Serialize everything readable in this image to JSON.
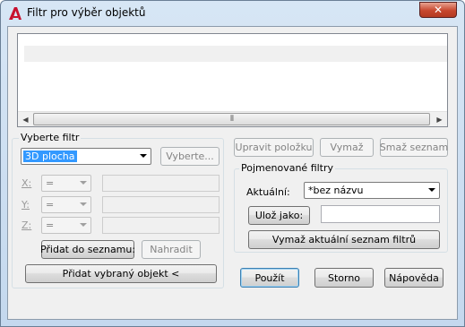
{
  "window": {
    "title": "Filtr pro výběr objektů",
    "close_symbol": "✕",
    "accent_color": "#c7472e"
  },
  "list": {
    "rows": [
      ""
    ],
    "scrollbar": {
      "left_arrow": "◀",
      "right_arrow": "▶",
      "grip": "⦀"
    }
  },
  "filter_group": {
    "title": "Vyberte filtr",
    "filter_select": {
      "value": "3D plocha"
    },
    "select_button": "Vyberte...",
    "coords": [
      {
        "label": "X:",
        "operator": "=",
        "value": ""
      },
      {
        "label": "Y:",
        "operator": "=",
        "value": ""
      },
      {
        "label": "Z:",
        "operator": "=",
        "value": ""
      }
    ],
    "add_to_list_button": "Přidat do seznamu:",
    "replace_button": "Nahradit",
    "add_selected_button": "Přidat vybraný objekt <"
  },
  "edit_buttons": {
    "edit_item": "Upravit položku",
    "delete": "Vymaž",
    "clear_list": "Smaž seznam"
  },
  "named_group": {
    "title": "Pojmenované filtry",
    "current_label": "Aktuální:",
    "current_value": "*bez názvu",
    "save_as_button": "Ulož jako:",
    "save_as_value": "",
    "delete_current_button": "Vymaž aktuální seznam filtrů"
  },
  "footer": {
    "apply": "Použít",
    "cancel": "Storno",
    "help": "Nápověda"
  }
}
